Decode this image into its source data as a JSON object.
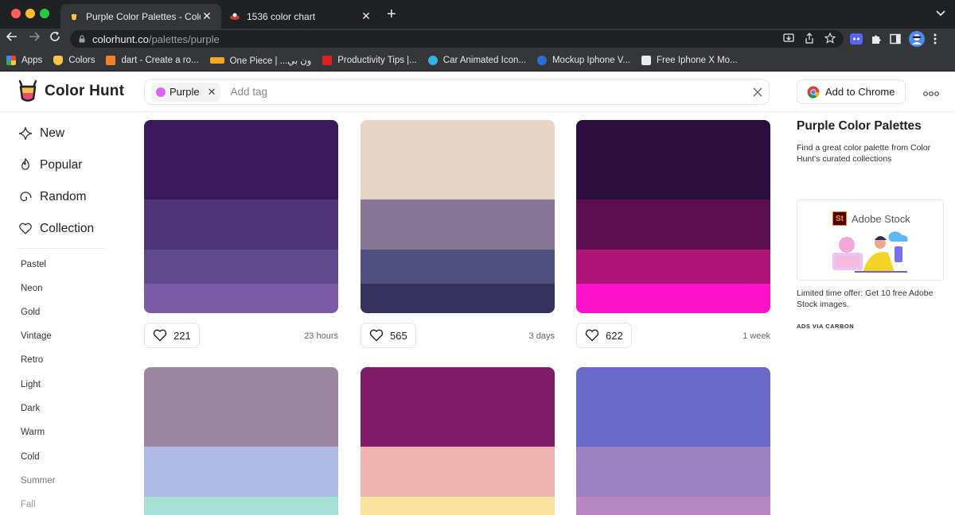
{
  "browser": {
    "tabs": [
      {
        "title": "Purple Color Palettes - Color H",
        "active": true
      },
      {
        "title": "1536 color chart",
        "active": false
      }
    ],
    "url_host": "colorhunt.co",
    "url_path": "/palettes/purple",
    "bookmarks": [
      {
        "label": "Apps",
        "color": "#e8453c"
      },
      {
        "label": "Colors",
        "color": "#f6c744"
      },
      {
        "label": "dart - Create a ro...",
        "color": "#f48024"
      },
      {
        "label": "One Piece | ...ون بي",
        "color": "#f5a623"
      },
      {
        "label": "Productivity Tips |...",
        "color": "#e02020"
      },
      {
        "label": "Car Animated Icon...",
        "color": "#2fb5e0"
      },
      {
        "label": "Mockup Iphone V...",
        "color": "#2b6fd6"
      },
      {
        "label": "Free Iphone X Mo...",
        "color": "#e8eaed"
      }
    ]
  },
  "header": {
    "logo_text": "Color Hunt",
    "tag_label": "Purple",
    "tag_color": "#d965f3",
    "search_placeholder": "Add tag",
    "add_to_chrome": "Add to Chrome"
  },
  "sidebar": {
    "nav": [
      {
        "label": "New",
        "icon": "sparkle-icon"
      },
      {
        "label": "Popular",
        "icon": "flame-icon"
      },
      {
        "label": "Random",
        "icon": "spiral-icon"
      },
      {
        "label": "Collection",
        "icon": "heart-icon"
      }
    ],
    "tags": [
      "Pastel",
      "Neon",
      "Gold",
      "Vintage",
      "Retro",
      "Light",
      "Dark",
      "Warm",
      "Cold",
      "Summer",
      "Fall"
    ]
  },
  "palettes": [
    {
      "colors": [
        "#3a1a5c",
        "#4f3479",
        "#5f4b8b",
        "#7b5aa6"
      ],
      "likes": "221",
      "age": "23 hours"
    },
    {
      "colors": [
        "#e8d5c9",
        "#877696",
        "#50507f",
        "#35325d"
      ],
      "likes": "565",
      "age": "3 days"
    },
    {
      "colors": [
        "#2c0e3d",
        "#5c0f4e",
        "#ae1478",
        "#fb12c9"
      ],
      "likes": "622",
      "age": "1 week"
    },
    {
      "colors": [
        "#9b86a0",
        "#afbbe5",
        "#a6e0d6"
      ],
      "likes": "",
      "age": ""
    },
    {
      "colors": [
        "#7f1d69",
        "#efb3b2",
        "#fbe29e"
      ],
      "likes": "",
      "age": ""
    },
    {
      "colors": [
        "#6b69c8",
        "#9c82c2",
        "#b787c2"
      ],
      "likes": "",
      "age": ""
    }
  ],
  "rail": {
    "title": "Purple Color Palettes",
    "description": "Find a great color palette from Color Hunt's curated collections",
    "ad_brand": "Adobe Stock",
    "ad_logo": "St",
    "ad_text": "Limited time offer: Get 10 free Adobe Stock images.",
    "ad_via": "ADS VIA CARBON"
  }
}
